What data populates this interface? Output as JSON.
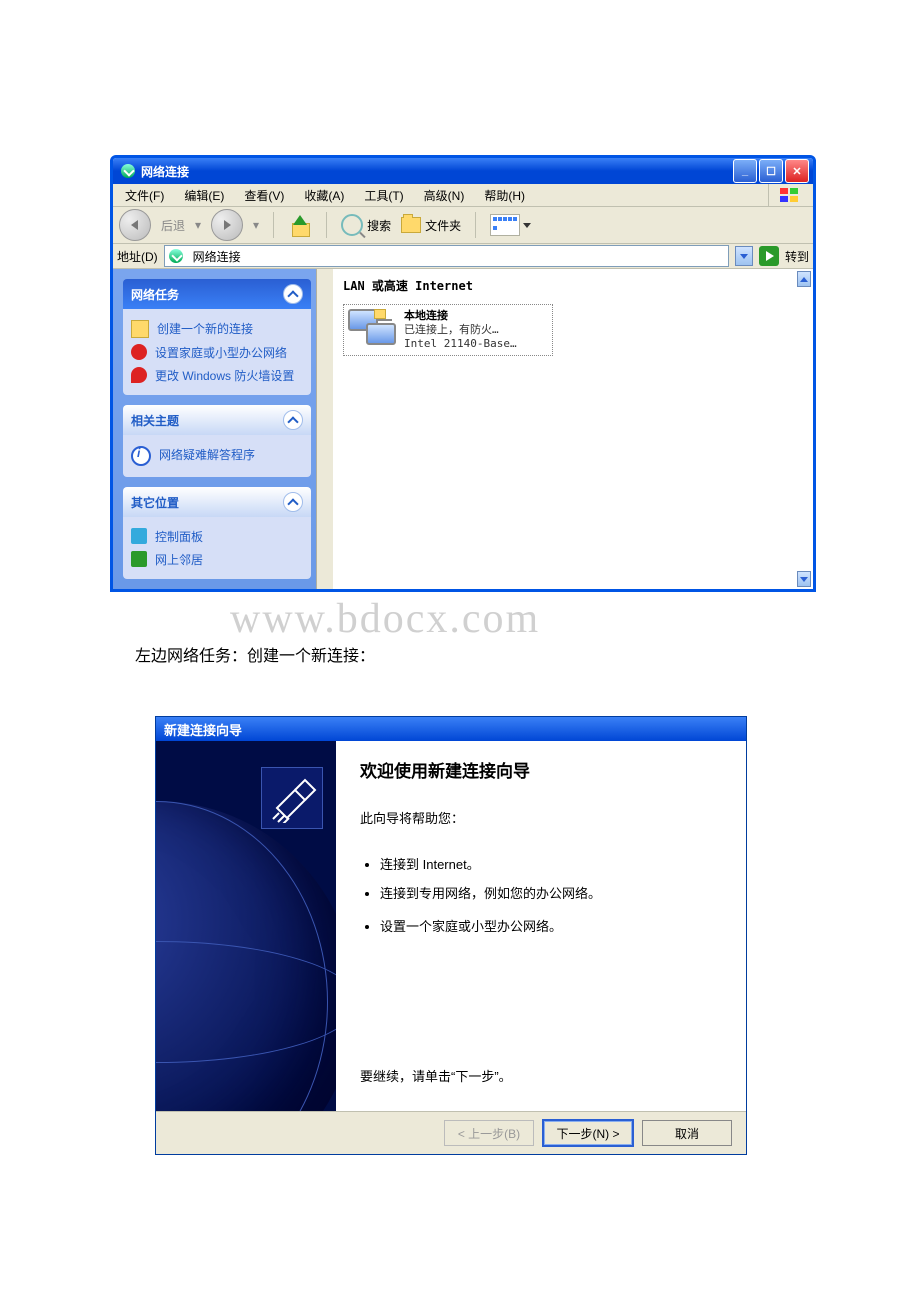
{
  "watermark": "www.bdocx.com",
  "explorer": {
    "title": "网络连接",
    "menu": {
      "file": "文件(F)",
      "edit": "编辑(E)",
      "view": "查看(V)",
      "favorites": "收藏(A)",
      "tools": "工具(T)",
      "advanced": "高级(N)",
      "help": "帮助(H)"
    },
    "toolbar": {
      "back": "后退",
      "search": "搜索",
      "folders": "文件夹"
    },
    "address": {
      "label": "地址(D)",
      "value": "网络连接",
      "go": "转到"
    },
    "sidebar": {
      "tasks_title": "网络任务",
      "tasks": {
        "new_conn": "创建一个新的连接",
        "home_net": "设置家庭或小型办公网络",
        "firewall": "更改 Windows 防火墙设置"
      },
      "related_title": "相关主题",
      "related": {
        "trouble": "网络疑难解答程序"
      },
      "other_title": "其它位置",
      "other": {
        "control_panel": "控制面板",
        "neighbors": "网上邻居"
      }
    },
    "main": {
      "category": "LAN 或高速 Internet",
      "conn": {
        "title": "本地连接",
        "status": "已连接上，有防火…",
        "device": "Intel 21140-Base…"
      }
    }
  },
  "caption": "左边网络任务：创建一个新连接：",
  "wizard": {
    "title": "新建连接向导",
    "heading": "欢迎使用新建连接向导",
    "intro": "此向导将帮助您：",
    "bullets": {
      "b1": "连接到 Internet。",
      "b2": "连接到专用网络，例如您的办公网络。",
      "b3": "设置一个家庭或小型办公网络。"
    },
    "continue": "要继续，请单击“下一步”。",
    "buttons": {
      "back": "< 上一步(B)",
      "next": "下一步(N) >",
      "cancel": "取消"
    }
  }
}
